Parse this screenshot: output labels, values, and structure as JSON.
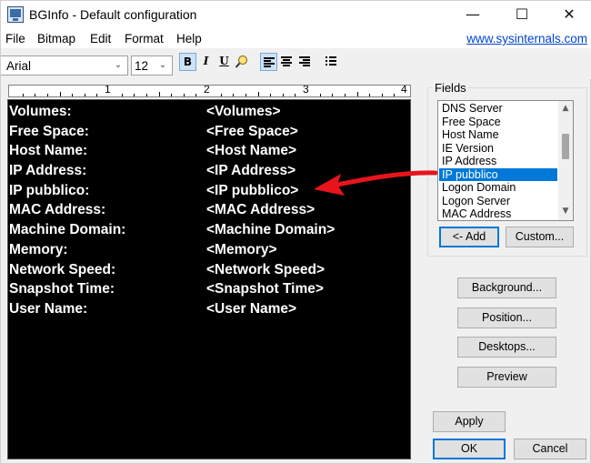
{
  "window": {
    "title": "BGInfo - Default configuration",
    "caption_buttons": {
      "minimize": "—",
      "maximize": "☐",
      "close": "✕"
    }
  },
  "menu": {
    "items": [
      "File",
      "Bitmap",
      "Edit",
      "Format",
      "Help"
    ],
    "link": "www.sysinternals.com"
  },
  "toolbar": {
    "font_name": "Arial",
    "font_size": "12",
    "bold": "B",
    "italic": "I",
    "underline": "U"
  },
  "ruler": {
    "numbers": [
      "1",
      "2",
      "3",
      "4"
    ]
  },
  "editor": {
    "rows": [
      {
        "label": "Volumes:",
        "field": "<Volumes>"
      },
      {
        "label": "Free Space:",
        "field": "<Free Space>"
      },
      {
        "label": "Host Name:",
        "field": "<Host Name>"
      },
      {
        "label": "IP Address:",
        "field": "<IP Address>"
      },
      {
        "label": "IP pubblico:",
        "field": "<IP pubblico>"
      },
      {
        "label": "MAC Address:",
        "field": "<MAC Address>"
      },
      {
        "label": "Machine Domain:",
        "field": "<Machine Domain>"
      },
      {
        "label": "Memory:",
        "field": "<Memory>"
      },
      {
        "label": "Network Speed:",
        "field": "<Network Speed>"
      },
      {
        "label": "Snapshot Time:",
        "field": "<Snapshot Time>"
      },
      {
        "label": "User Name:",
        "field": "<User Name>"
      }
    ]
  },
  "fields": {
    "legend": "Fields",
    "items": [
      "DNS Server",
      "Free Space",
      "Host Name",
      "IE Version",
      "IP Address",
      "IP pubblico",
      "Logon Domain",
      "Logon Server",
      "MAC Address"
    ],
    "selected": "IP pubblico",
    "add_label": "<- Add",
    "custom_label": "Custom..."
  },
  "buttons": {
    "background": "Background...",
    "position": "Position...",
    "desktops": "Desktops...",
    "preview": "Preview",
    "apply": "Apply",
    "ok": "OK",
    "cancel": "Cancel"
  },
  "colors": {
    "selection": "#0078d7",
    "annotation_arrow": "#e8141c",
    "editor_bg": "#000000",
    "link": "#0044cc"
  }
}
